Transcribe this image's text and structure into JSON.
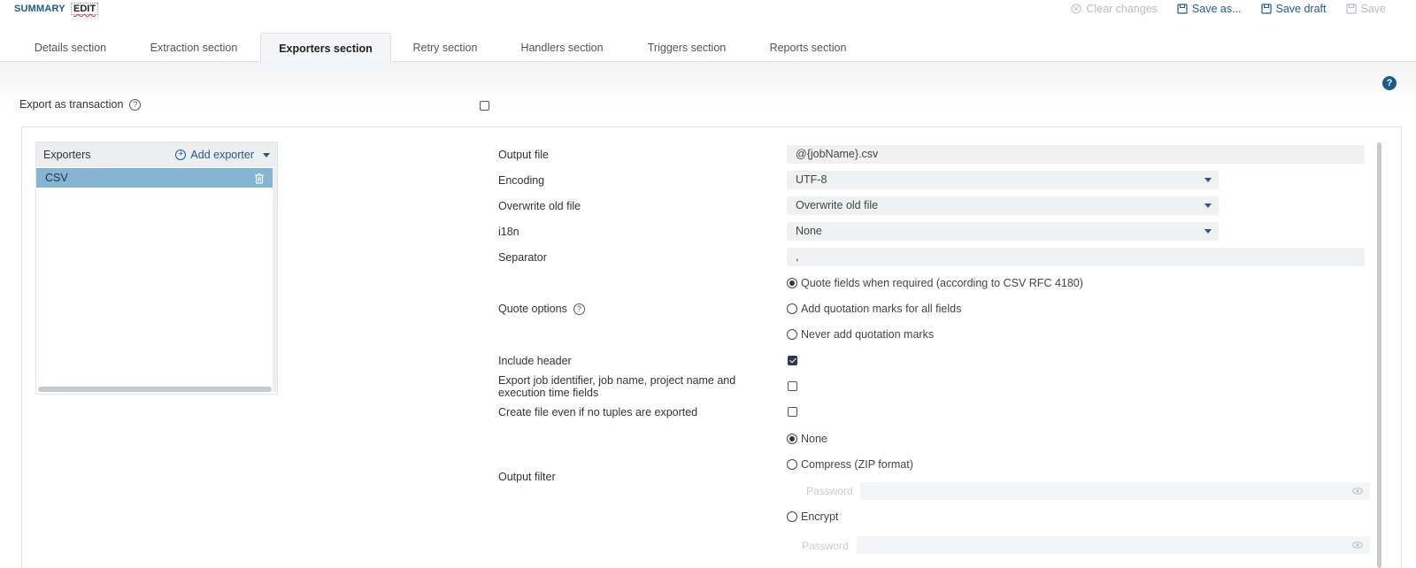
{
  "modes": {
    "summary": "SUMMARY",
    "edit": "EDIT"
  },
  "actions": {
    "clear": "Clear changes",
    "save_as": "Save as...",
    "save_draft": "Save draft",
    "save": "Save"
  },
  "tabs": [
    {
      "label": "Details section"
    },
    {
      "label": "Extraction section"
    },
    {
      "label": "Exporters section",
      "active": true
    },
    {
      "label": "Retry section"
    },
    {
      "label": "Handlers section"
    },
    {
      "label": "Triggers section"
    },
    {
      "label": "Reports section"
    }
  ],
  "export_transaction": {
    "label": "Export as transaction",
    "checked": false
  },
  "help_symbol": "?",
  "exporters": {
    "title": "Exporters",
    "add_label": "Add exporter",
    "items": [
      {
        "label": "CSV",
        "selected": true
      }
    ]
  },
  "form": {
    "output_file": {
      "label": "Output file",
      "value": "@{jobName}.csv"
    },
    "encoding": {
      "label": "Encoding",
      "value": "UTF-8"
    },
    "overwrite": {
      "label": "Overwrite old file",
      "value": "Overwrite old file"
    },
    "i18n": {
      "label": "i18n",
      "value": "None"
    },
    "separator": {
      "label": "Separator",
      "value": ","
    },
    "quote_options": {
      "label": "Quote options",
      "options": [
        {
          "label": "Quote fields when required (according to CSV RFC 4180)",
          "selected": true
        },
        {
          "label": "Add quotation marks for all fields",
          "selected": false
        },
        {
          "label": "Never add quotation marks",
          "selected": false
        }
      ]
    },
    "include_header": {
      "label": "Include header",
      "checked": true
    },
    "export_job_fields": {
      "label": "Export job identifier, job name, project name and execution time fields",
      "checked": false
    },
    "create_file_empty": {
      "label": "Create file even if no tuples are exported",
      "checked": false
    },
    "output_filter": {
      "label": "Output filter",
      "options": [
        {
          "label": "None",
          "selected": true
        },
        {
          "label": "Compress (ZIP format)",
          "selected": false
        },
        {
          "label": "Encrypt",
          "selected": false
        }
      ],
      "password_placeholder": "Password"
    }
  }
}
